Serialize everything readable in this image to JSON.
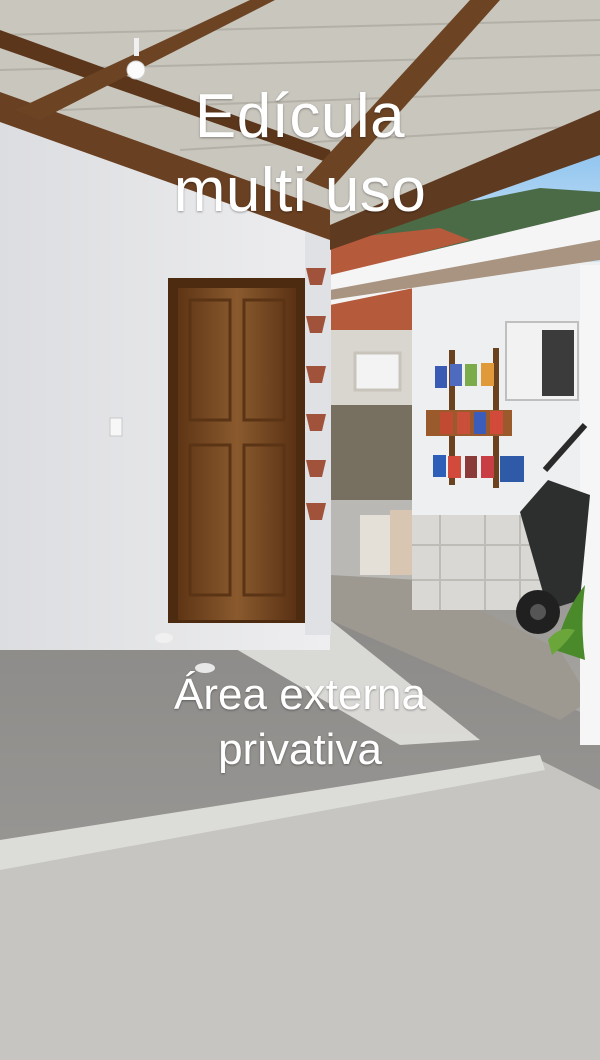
{
  "overlay_text": {
    "title_line_1": "Edícula",
    "title_line_2": "multi uso",
    "subtitle_line_1": "Área externa",
    "subtitle_line_2": "privativa"
  },
  "colors": {
    "caption": "#ffffff",
    "wall": "#e9e9ea",
    "door": "#7a4a24",
    "roof_tiles": "#b65a3c",
    "floor": "#b8b7b3"
  }
}
